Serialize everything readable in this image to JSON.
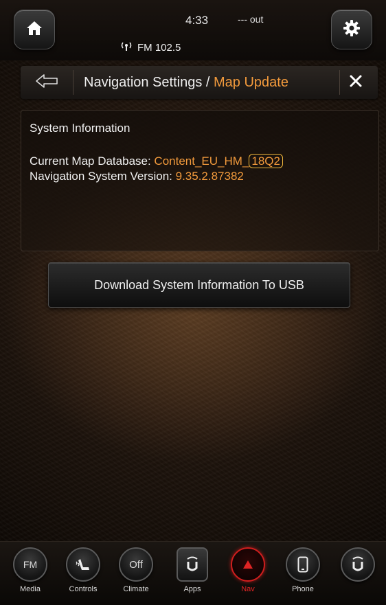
{
  "status": {
    "clock": "4:33",
    "outside_temp": "--- out",
    "radio": "FM 102.5",
    "icons": [
      "home-icon",
      "antenna-icon",
      "gear-icon"
    ]
  },
  "titlebar": {
    "title_main": "Navigation Settings / ",
    "title_accent": "Map Update",
    "accent_color": "#f29a3c",
    "icons": [
      "back-arrow-icon",
      "close-icon"
    ]
  },
  "panel": {
    "heading": "System Information",
    "map_db_label": "Current Map Database: ",
    "map_db_value": "Content_EU_HM_",
    "map_db_version": "18Q2",
    "nav_version_label": "Navigation System Version: ",
    "nav_version_value": "9.35.2.87382"
  },
  "download_button": {
    "label": "Download System Information To USB"
  },
  "bottom_nav": {
    "items": [
      {
        "label": "Media",
        "glyph": "FM",
        "icon": "fm-icon"
      },
      {
        "label": "Controls",
        "icon": "seat-icon"
      },
      {
        "label": "Climate",
        "glyph": "Off",
        "icon": "climate-icon"
      },
      {
        "label": "Apps",
        "icon": "uconnect-icon"
      },
      {
        "label": "Nav",
        "icon": "nav-arrow-icon",
        "active": true,
        "active_color": "#e02424"
      },
      {
        "label": "Phone",
        "icon": "phone-icon"
      },
      {
        "label": "",
        "icon": "uconnect-icon"
      }
    ]
  }
}
